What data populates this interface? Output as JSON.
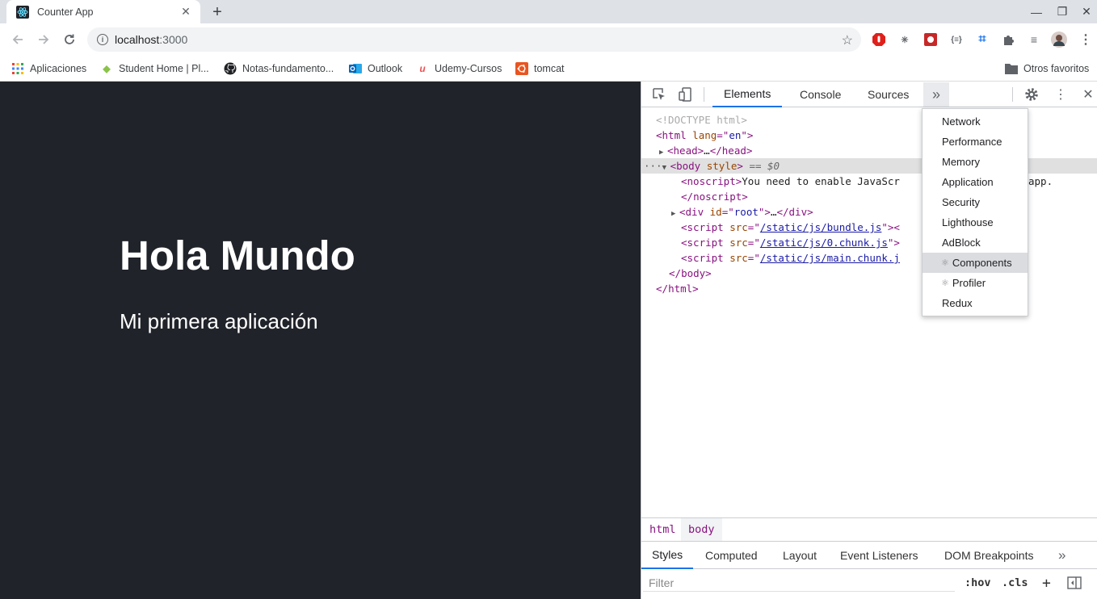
{
  "tab": {
    "title": "Counter App"
  },
  "omnibox": {
    "host": "localhost",
    "port": ":3000"
  },
  "bookmarks": [
    {
      "label": "Aplicaciones",
      "icon": "apps-grid-icon"
    },
    {
      "label": "Student Home | Pl...",
      "icon": "diamond-icon"
    },
    {
      "label": "Notas-fundamento...",
      "icon": "github-icon"
    },
    {
      "label": "Outlook",
      "icon": "outlook-icon"
    },
    {
      "label": "Udemy-Cursos",
      "icon": "udemy-icon"
    },
    {
      "label": "tomcat",
      "icon": "ubuntu-icon"
    }
  ],
  "other_bookmarks": "Otros favoritos",
  "page": {
    "heading": "Hola Mundo",
    "subheading": "Mi primera aplicación",
    "background": "#20232a"
  },
  "devtools": {
    "tabs": [
      "Elements",
      "Console",
      "Sources"
    ],
    "active_tab": "Elements",
    "elements_lines": {
      "doctype": "<!DOCTYPE html>",
      "html_open_tag": "html",
      "html_lang_attr": "lang",
      "html_lang_val": "en",
      "head": "head",
      "head_ellipsis": "…",
      "body_tag": "body",
      "body_attr": "style",
      "body_eq": "== $0",
      "noscript_tag": "noscript",
      "noscript_text": "You need to enable JavaScr",
      "noscript_tail": "app.",
      "div_tag": "div",
      "div_attr": "id",
      "div_val": "root",
      "div_ellipsis": "…",
      "script_tag": "script",
      "script_attr": "src",
      "script1": "/static/js/bundle.js",
      "script2": "/static/js/0.chunk.js",
      "script3": "/static/js/main.chunk.j",
      "body_close": "body",
      "html_close": "html"
    },
    "breadcrumbs": [
      "html",
      "body"
    ],
    "subtabs": [
      "Styles",
      "Computed",
      "Layout",
      "Event Listeners",
      "DOM Breakpoints"
    ],
    "active_subtab": "Styles",
    "filter_placeholder": "Filter",
    "hov": ":hov",
    "cls": ".cls",
    "overflow_menu": [
      {
        "label": "Network",
        "highlighted": false,
        "react_icon": false
      },
      {
        "label": "Performance",
        "highlighted": false,
        "react_icon": false
      },
      {
        "label": "Memory",
        "highlighted": false,
        "react_icon": false
      },
      {
        "label": "Application",
        "highlighted": false,
        "react_icon": false
      },
      {
        "label": "Security",
        "highlighted": false,
        "react_icon": false
      },
      {
        "label": "Lighthouse",
        "highlighted": false,
        "react_icon": false
      },
      {
        "label": "AdBlock",
        "highlighted": false,
        "react_icon": false
      },
      {
        "label": "Components",
        "highlighted": true,
        "react_icon": true
      },
      {
        "label": "Profiler",
        "highlighted": false,
        "react_icon": true
      },
      {
        "label": "Redux",
        "highlighted": false,
        "react_icon": false
      }
    ]
  }
}
